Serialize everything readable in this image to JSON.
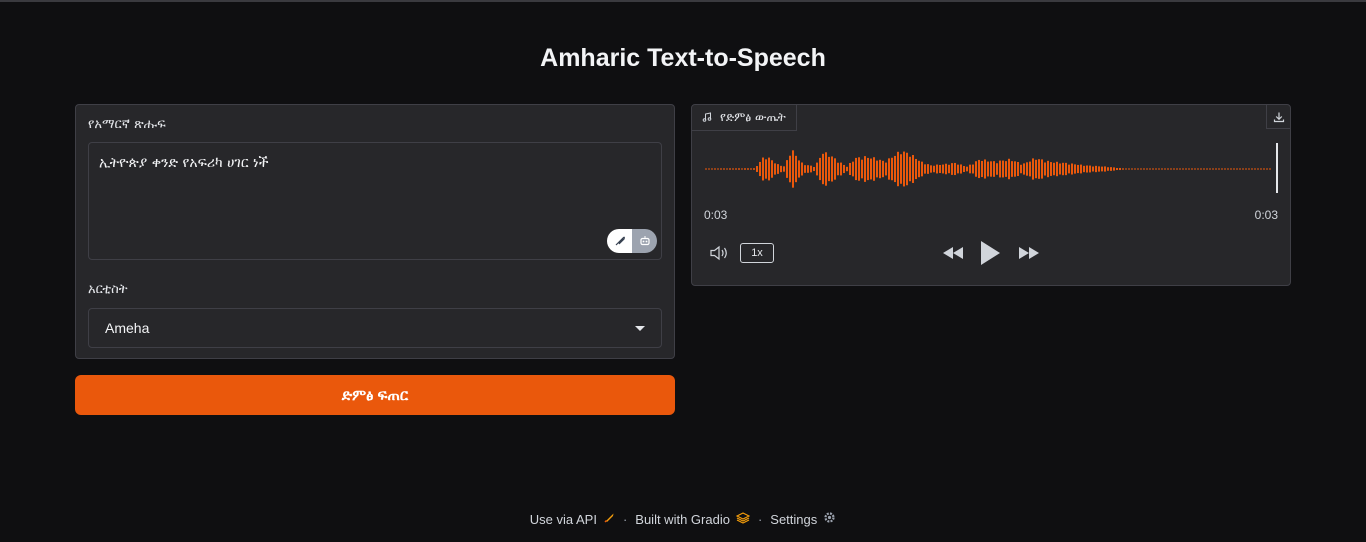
{
  "app": {
    "title": "Amharic Text-to-Speech"
  },
  "input_panel": {
    "text_label": "የአማርኛ ጽሑፍ",
    "text_value": "ኢትዮጵያ ቀንድ የአፍሪካ ሀገር ነች",
    "speaker_label": "አርቲስት",
    "speaker_value": "Ameha"
  },
  "generate_button": {
    "label": "ድምፅ ፍጠር"
  },
  "output_panel": {
    "tab_label": "የድምፅ ውጤት",
    "current_time": "0:03",
    "duration": "0:03",
    "playback_speed": "1x",
    "waveform_color": "#ea580c",
    "progress_fraction": 1.0
  },
  "footer": {
    "api_label": "Use via API",
    "built_label": "Built with Gradio",
    "settings_label": "Settings",
    "separator": "·"
  },
  "colors": {
    "background": "#0f0f11",
    "panel": "#27272a",
    "accent": "#ea580c"
  }
}
